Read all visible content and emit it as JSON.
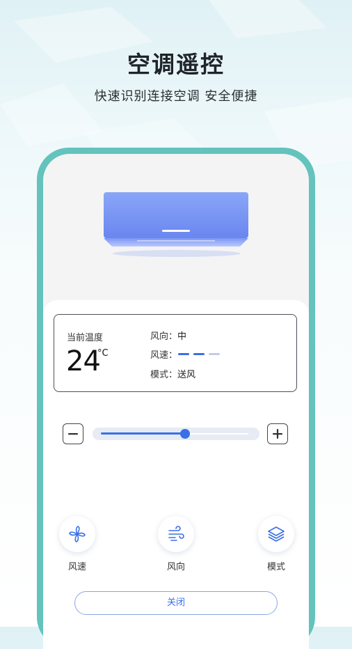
{
  "header": {
    "title": "空调遥控",
    "subtitle": "快速识别连接空调 安全便捷"
  },
  "status": {
    "temp_label": "当前温度",
    "temperature": "24",
    "unit": "°C",
    "direction_label": "风向：",
    "direction_value": "中",
    "speed_label": "风速：",
    "speed_level": 2,
    "speed_max": 3,
    "mode_label": "模式：",
    "mode_value": "送风"
  },
  "slider": {
    "value_fraction": 0.57
  },
  "controls": [
    {
      "label": "风速",
      "icon": "fan-icon"
    },
    {
      "label": "风向",
      "icon": "wind-icon"
    },
    {
      "label": "模式",
      "icon": "layers-icon"
    }
  ],
  "close_label": "关闭",
  "colors": {
    "accent": "#3a6fe6",
    "frame": "#64c3bc",
    "bar_inactive": "#c5cbe0"
  }
}
